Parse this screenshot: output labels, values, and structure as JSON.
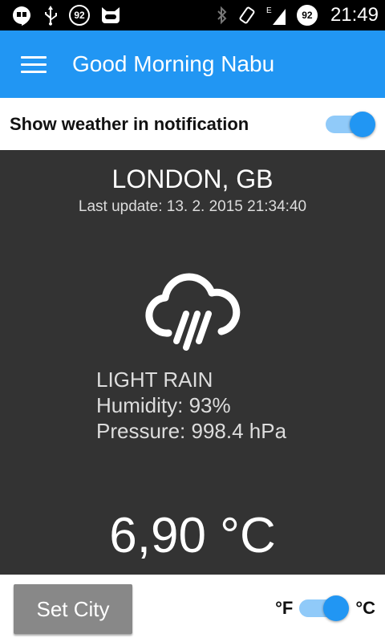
{
  "status_bar": {
    "left_icons": [
      "hangouts-icon",
      "usb-icon",
      "notification-count-icon",
      "cyanogen-icon"
    ],
    "notification_count": "92",
    "battery_level": "92",
    "network_type": "E",
    "time": "21:49",
    "right_icons": [
      "bluetooth-icon",
      "vibrate-icon",
      "signal-icon",
      "battery-icon"
    ]
  },
  "app_bar": {
    "title": "Good Morning Nabu",
    "menu_icon": "hamburger-menu-icon",
    "color": "#2196f3"
  },
  "notification_setting": {
    "label": "Show weather in notification",
    "enabled": true
  },
  "weather": {
    "city": "LONDON, GB",
    "last_update": "Last update: 13. 2. 2015 21:34:40",
    "icon": "rain-cloud-icon",
    "condition": "LIGHT RAIN",
    "humidity": "Humidity: 93%",
    "pressure": "Pressure: 998.4 hPa",
    "temperature": "6,90 °C"
  },
  "bottom_bar": {
    "set_city_label": "Set City",
    "unit_left": "°F",
    "unit_right": "°C",
    "celsius_selected": true
  },
  "colors": {
    "accent": "#2196f3",
    "accent_light": "#90caf9",
    "panel_bg": "#333333",
    "button_bg": "#888888"
  }
}
